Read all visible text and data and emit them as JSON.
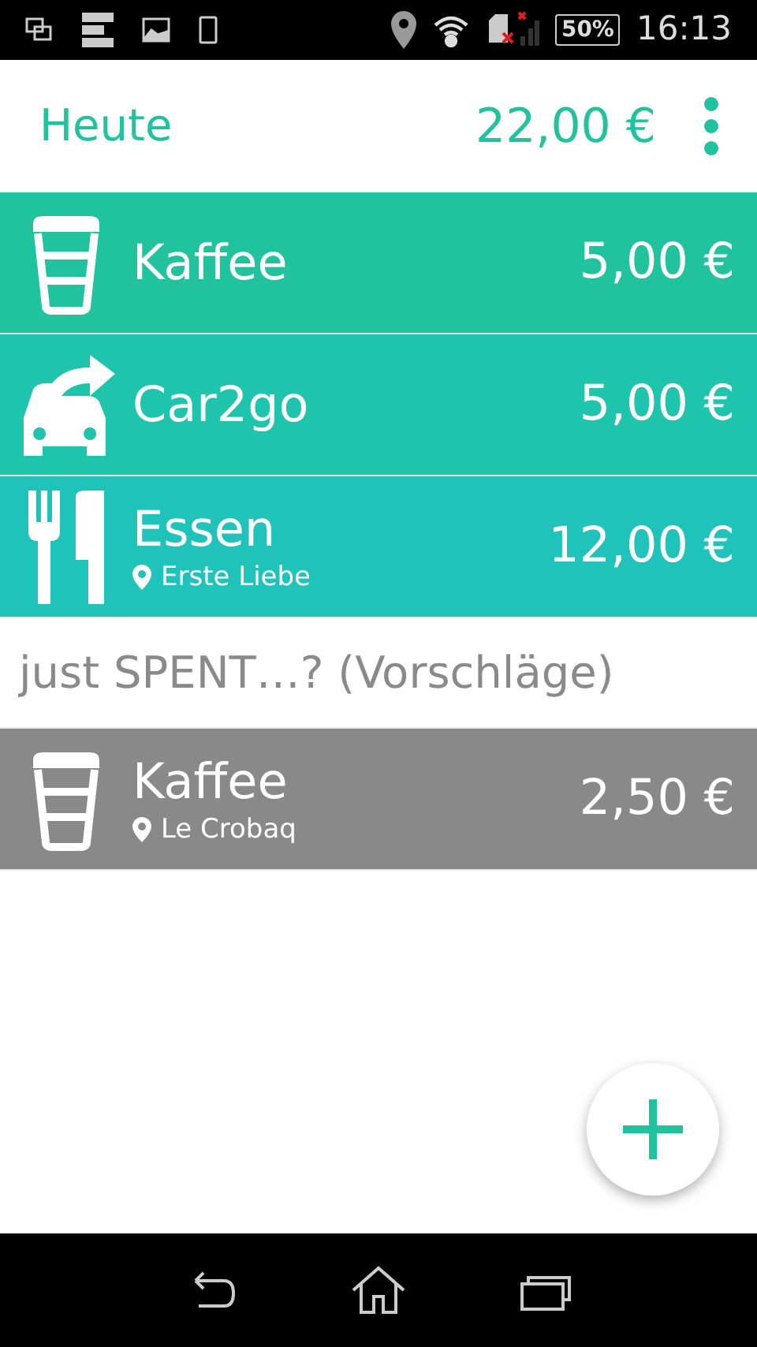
{
  "status_bar": {
    "battery": "50%",
    "time": "16:13"
  },
  "header": {
    "title": "Heute",
    "total": "22,00 €"
  },
  "entries": [
    {
      "kind": "cup",
      "name": "Kaffee",
      "amount": "5,00 €",
      "color": "#20c39e"
    },
    {
      "kind": "car",
      "name": "Car2go",
      "amount": "5,00 €",
      "color": "#1fc4ac"
    },
    {
      "kind": "cutlery",
      "name": "Essen",
      "location": "Erste Liebe",
      "amount": "12,00 €",
      "color": "#1fc3ba"
    }
  ],
  "suggestions": {
    "title": "just SPENT…? (Vorschläge)",
    "items": [
      {
        "kind": "cup",
        "name": "Kaffee",
        "location": "Le Crobaq",
        "amount": "2,50 €",
        "color": "#898989"
      }
    ]
  }
}
